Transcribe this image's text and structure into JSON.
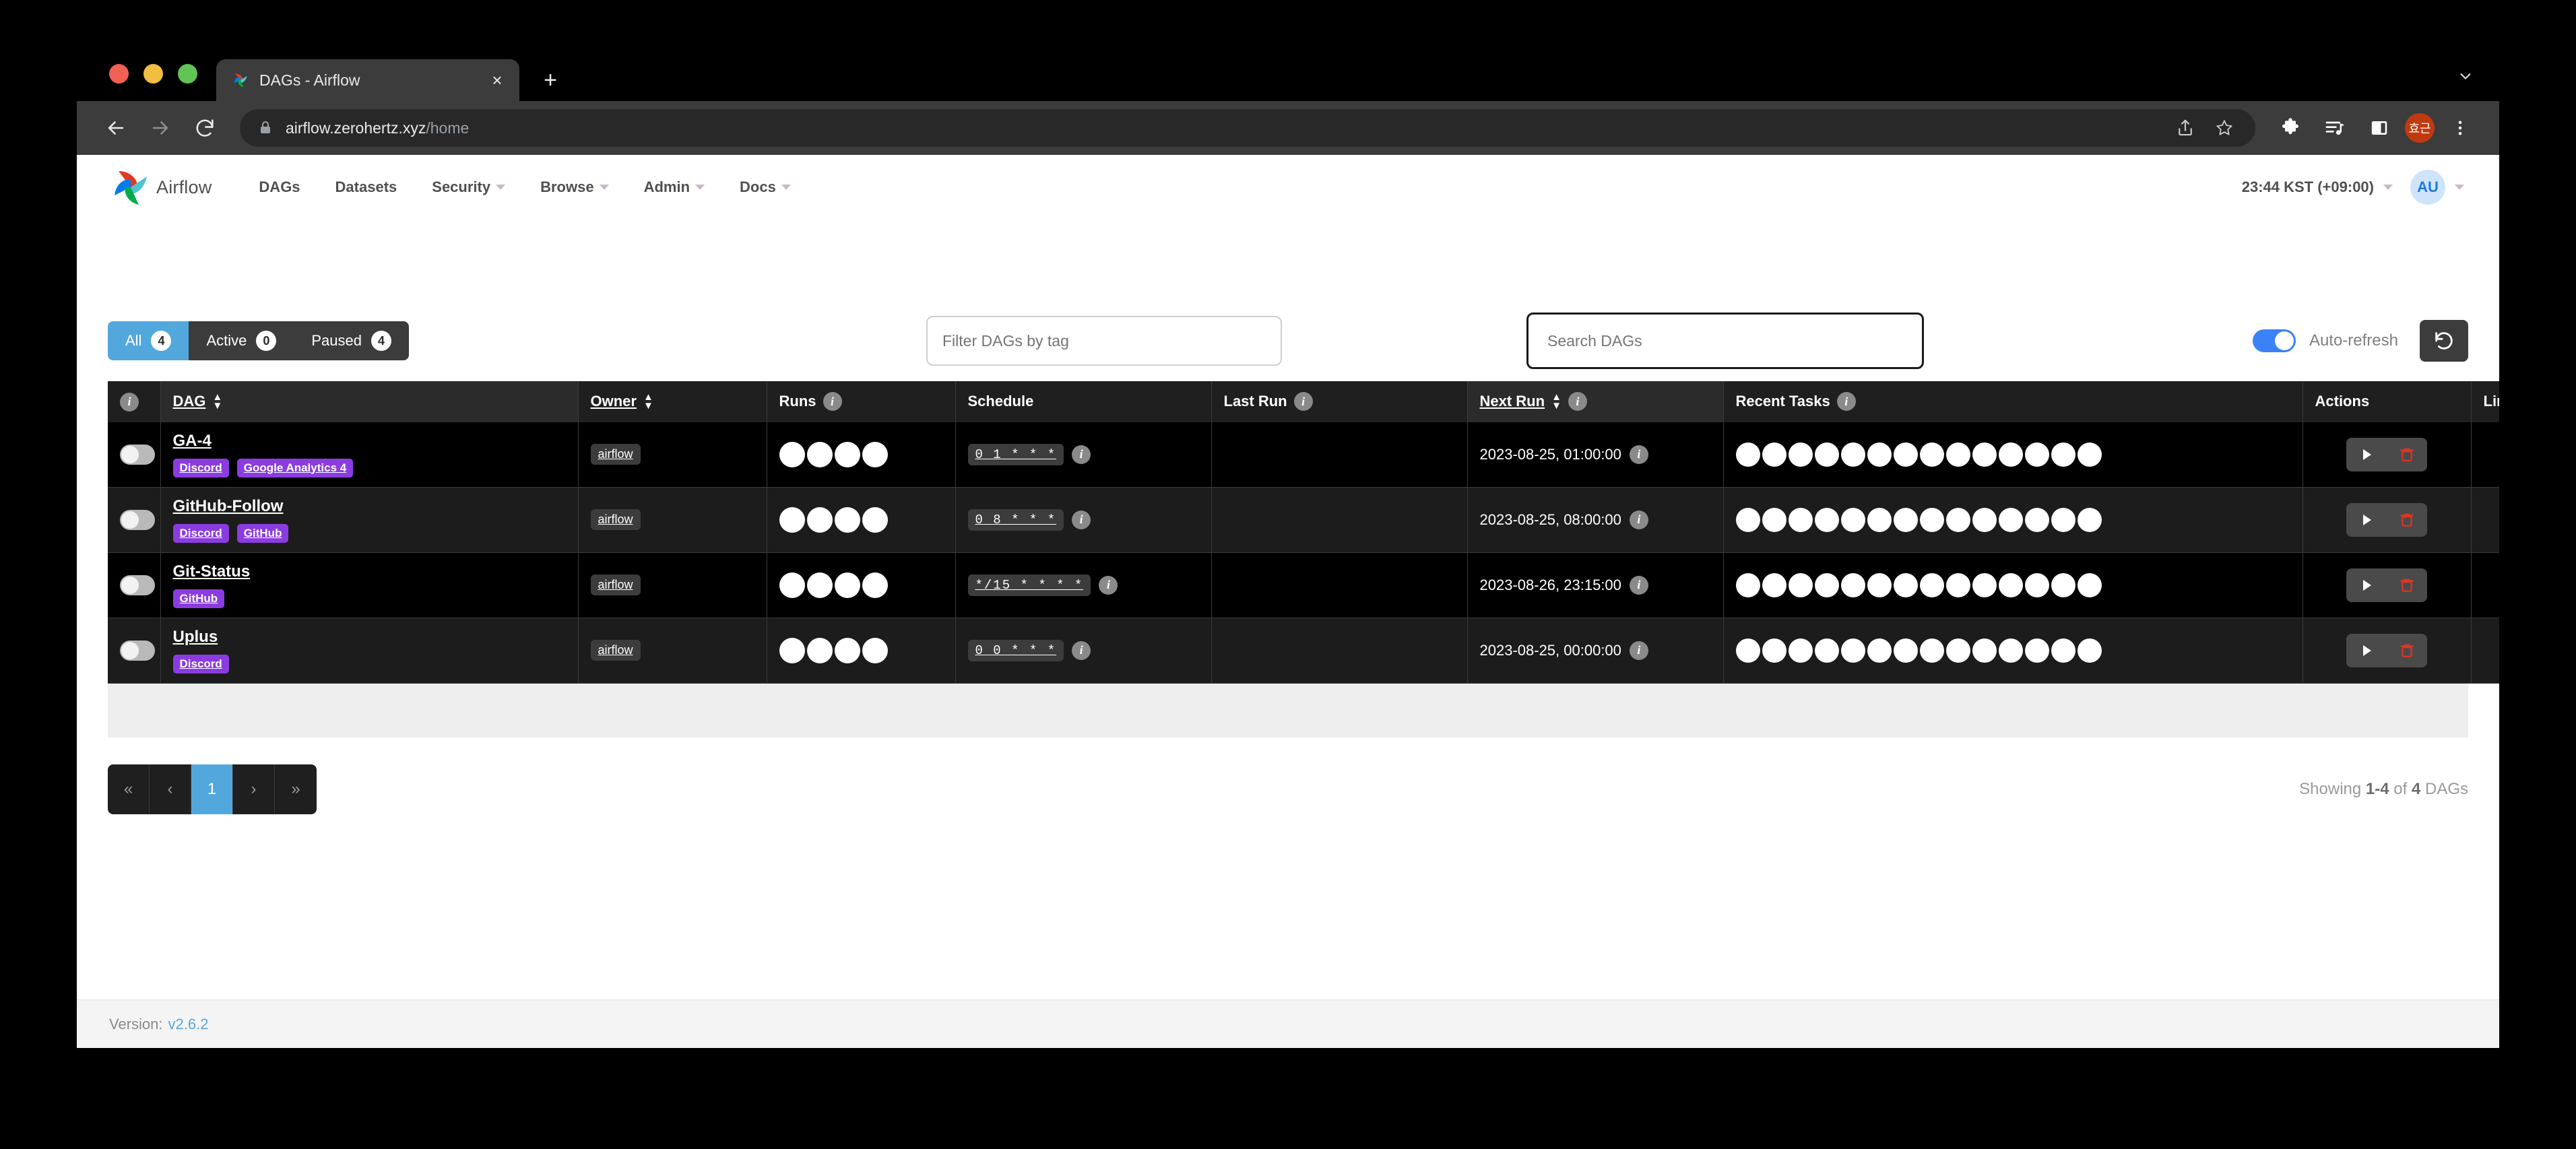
{
  "browser": {
    "tab": {
      "title": "DAGs - Airflow",
      "favicon": "airflow-pinwheel-icon",
      "close": "×"
    },
    "new_tab": "+",
    "url_host": "airflow.zerohertz.xyz",
    "url_path": "/home",
    "profile_initial": "효근",
    "icons": [
      "back-icon",
      "forward-icon",
      "reload-icon",
      "lock-icon",
      "share-icon",
      "bookmark-star-icon",
      "extensions-puzzle-icon",
      "reading-list-icon",
      "side-panel-icon",
      "profile-avatar",
      "chrome-menu-icon",
      "tabsearch-chevron-icon"
    ]
  },
  "navbar": {
    "brand": "Airflow",
    "items": [
      {
        "label": "DAGs",
        "has_caret": false
      },
      {
        "label": "Datasets",
        "has_caret": false
      },
      {
        "label": "Security",
        "has_caret": true
      },
      {
        "label": "Browse",
        "has_caret": true
      },
      {
        "label": "Admin",
        "has_caret": true
      },
      {
        "label": "Docs",
        "has_caret": true
      }
    ],
    "timezone": "23:44 KST (+09:00)",
    "avatar_initials": "AU"
  },
  "toolbar": {
    "filters": [
      {
        "label": "All",
        "count": "4",
        "active": true
      },
      {
        "label": "Active",
        "count": "0",
        "active": false
      },
      {
        "label": "Paused",
        "count": "4",
        "active": false
      }
    ],
    "tag_filter_placeholder": "Filter DAGs by tag",
    "search_placeholder": "Search DAGs",
    "autorefresh_label": "Auto-refresh",
    "autorefresh_on": true,
    "refresh_icon": "refresh-icon"
  },
  "table": {
    "headers": {
      "info": "info-icon",
      "dag": "DAG",
      "owner": "Owner",
      "runs": "Runs",
      "schedule": "Schedule",
      "last_run": "Last Run",
      "next_run": "Next Run",
      "recent_tasks": "Recent Tasks",
      "actions": "Actions",
      "links": "Links"
    },
    "rows": [
      {
        "paused": true,
        "name": "GA-4",
        "tags": [
          "Discord",
          "Google Analytics 4"
        ],
        "owner": "airflow",
        "runs_count": 4,
        "schedule": "0 1 * * *",
        "last_run": "",
        "next_run": "2023-08-25, 01:00:00",
        "recent_tasks_count": 14,
        "links": "•••"
      },
      {
        "paused": true,
        "name": "GitHub-Follow",
        "tags": [
          "Discord",
          "GitHub"
        ],
        "owner": "airflow",
        "runs_count": 4,
        "schedule": "0 8 * * *",
        "last_run": "",
        "next_run": "2023-08-25, 08:00:00",
        "recent_tasks_count": 14,
        "links": "•••"
      },
      {
        "paused": true,
        "name": "Git-Status",
        "tags": [
          "GitHub"
        ],
        "owner": "airflow",
        "runs_count": 4,
        "schedule": "*/15 * * * *",
        "last_run": "",
        "next_run": "2023-08-26, 23:15:00",
        "recent_tasks_count": 14,
        "links": "•••"
      },
      {
        "paused": true,
        "name": "Uplus",
        "tags": [
          "Discord"
        ],
        "owner": "airflow",
        "runs_count": 4,
        "schedule": "0 0 * * *",
        "last_run": "",
        "next_run": "2023-08-25, 00:00:00",
        "recent_tasks_count": 14,
        "links": "•••"
      }
    ],
    "action_icons": {
      "trigger": "play-icon",
      "delete": "trash-icon"
    }
  },
  "pagination": {
    "first": "«",
    "prev": "‹",
    "pages": [
      "1"
    ],
    "next": "›",
    "last": "»",
    "active_page": "1"
  },
  "showing": {
    "prefix": "Showing ",
    "range": "1-4",
    "middle": " of ",
    "total": "4",
    "suffix": " DAGs"
  },
  "footer": {
    "version_label": "Version:",
    "version": "v2.6.2"
  },
  "colors": {
    "accent_blue": "#52a8dd",
    "tag_purple": "#8b3ce0",
    "delete_red": "#e03523",
    "toggle_blue": "#3b82f6"
  }
}
